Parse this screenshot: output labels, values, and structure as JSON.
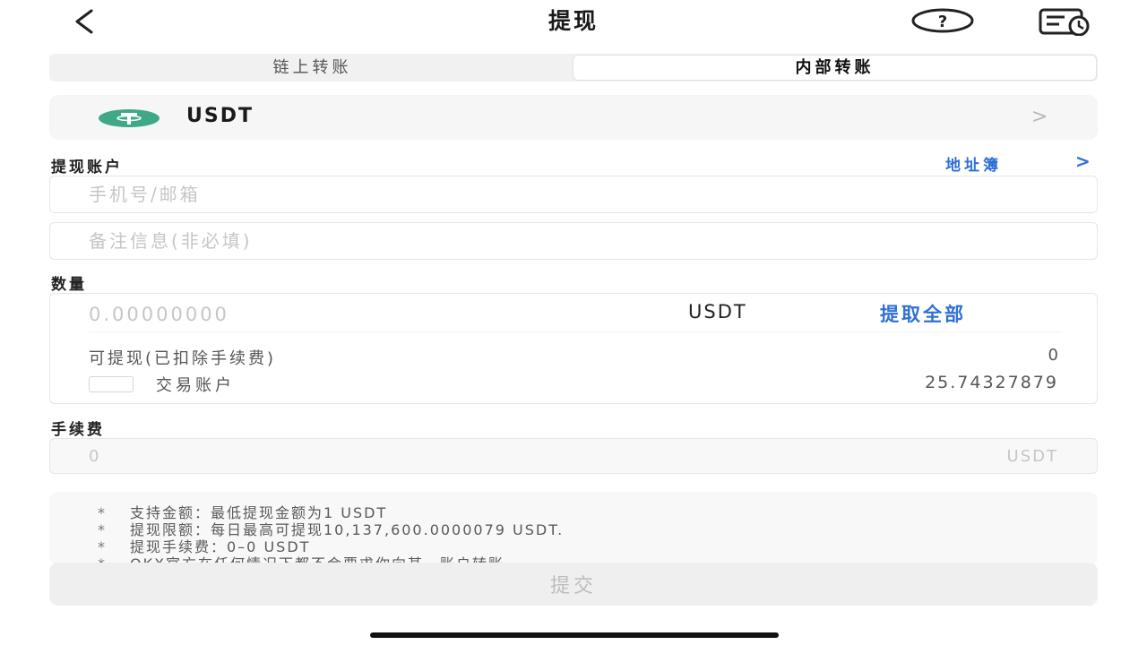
{
  "header": {
    "title": "提现"
  },
  "tabs": [
    {
      "label": "链上转账",
      "active": false
    },
    {
      "label": "内部转账",
      "active": true
    }
  ],
  "coin": {
    "name": "USDT",
    "chevron": ">",
    "logo_color": "#3fa887"
  },
  "withdraw_account": {
    "label": "提现账户",
    "address_book_label": "地址簿",
    "address_book_chevron": ">",
    "account_placeholder": "手机号/邮箱",
    "memo_placeholder": "备注信息(非必填)"
  },
  "amount": {
    "label": "数量",
    "placeholder": "0.00000000",
    "unit": "USDT",
    "withdraw_all_label": "提取全部",
    "available_label": "可提现(已扣除手续费)",
    "available_value": "0",
    "trade_account_label": "交易账户",
    "trade_account_checked": false,
    "trade_account_value": "25.74327879"
  },
  "fee": {
    "label": "手续费",
    "value": "0",
    "unit": "USDT"
  },
  "notes": [
    {
      "bullet": "*",
      "text": "支持金额：最低提现金额为1 USDT"
    },
    {
      "bullet": "*",
      "text": "提现限额：每日最高可提现10,137,600.0000079 USDT."
    },
    {
      "bullet": "*",
      "text": "提现手续费：0–0 USDT"
    },
    {
      "bullet": "*",
      "text": "OKX官方在任何情况下都不会要求你向某一账户转账"
    }
  ],
  "submit_label": "提交",
  "colors": {
    "accent": "#2f6fd6",
    "coin_green": "#3fa887"
  },
  "icons": {
    "back": "back-chevron-icon",
    "help": "question-circle-icon",
    "record": "record-list-icon"
  }
}
